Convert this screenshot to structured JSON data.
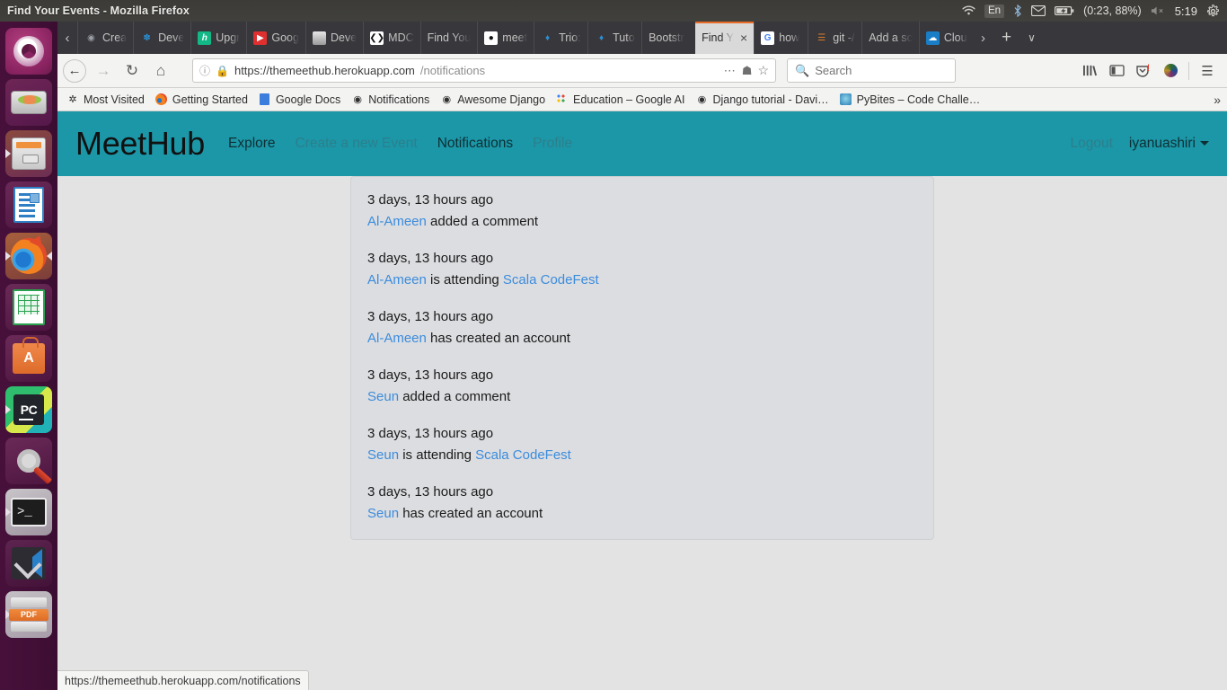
{
  "desktop": {
    "window_title": "Find Your Events - Mozilla Firefox",
    "tray": {
      "wifi_icon": "wifi-icon",
      "language": "En",
      "bluetooth_icon": "bluetooth-icon",
      "mail_icon": "mail-icon",
      "battery_icon": "battery-icon",
      "battery_label": "(0:23, 88%)",
      "volume_icon": "volume-muted-icon",
      "clock": "5:19",
      "gear_icon": "gear-icon"
    },
    "launcher": [
      {
        "name": "ubuntu-dash",
        "running": false
      },
      {
        "name": "disk-usage-analyzer",
        "running": false
      },
      {
        "name": "files-nautilus",
        "running": true
      },
      {
        "name": "libreoffice-writer",
        "running": false
      },
      {
        "name": "firefox",
        "running": true,
        "focused": true
      },
      {
        "name": "libreoffice-calc",
        "running": false
      },
      {
        "name": "ubuntu-software",
        "running": false
      },
      {
        "name": "pycharm",
        "running": true
      },
      {
        "name": "system-settings",
        "running": false
      },
      {
        "name": "terminal",
        "running": true
      },
      {
        "name": "visual-studio-code",
        "running": false
      },
      {
        "name": "pdf-tools",
        "running": true
      }
    ]
  },
  "browser": {
    "tabs": [
      {
        "label": "Crea",
        "favicon": "globe-icon",
        "active": false
      },
      {
        "label": "Deve",
        "favicon": "globe-icon",
        "active": false
      },
      {
        "label": "Upgr",
        "favicon": "hashnode-icon",
        "active": false
      },
      {
        "label": "Goog",
        "favicon": "youtube-icon",
        "active": false
      },
      {
        "label": "Deve",
        "favicon": "document-icon",
        "active": false
      },
      {
        "label": "MDC",
        "favicon": "mdn-icon",
        "active": false
      },
      {
        "label": "Find You",
        "favicon": "none",
        "active": false
      },
      {
        "label": "meet",
        "favicon": "github-icon",
        "active": false
      },
      {
        "label": "Trio:",
        "favicon": "trio-icon",
        "active": false
      },
      {
        "label": "Tuto",
        "favicon": "trio-icon",
        "active": false
      },
      {
        "label": "Bootstr",
        "favicon": "none",
        "active": false
      },
      {
        "label": "Find Y",
        "favicon": "none",
        "active": true
      },
      {
        "label": "how",
        "favicon": "google-icon",
        "active": false
      },
      {
        "label": "git -/",
        "favicon": "git-icon",
        "active": false
      },
      {
        "label": "Add a sc",
        "favicon": "none",
        "active": false
      },
      {
        "label": "Clou",
        "favicon": "cloud-icon",
        "active": false
      }
    ],
    "tab_close_label": "×",
    "new_tab_label": "+",
    "tab_list_label": "∨",
    "scroll_left_label": "‹",
    "scroll_right_label": "›",
    "nav": {
      "back_icon": "back-arrow-icon",
      "forward_icon": "forward-arrow-icon",
      "reload_icon": "reload-icon",
      "home_icon": "home-icon"
    },
    "url": {
      "info_icon": "page-info-icon",
      "lock_icon": "lock-icon",
      "scheme_host": "https://themeethub.herokuapp.com",
      "path": "/notifications",
      "page_actions_icon": "ellipsis-icon",
      "pocket_icon": "pocket-icon",
      "bookmark_star_icon": "star-icon"
    },
    "search": {
      "icon": "search-icon",
      "placeholder": "Search",
      "value": ""
    },
    "toolbar_icons": [
      "library-icon",
      "sidebar-icon",
      "save-to-pocket-icon",
      "account-avatar-icon",
      "hamburger-menu-icon"
    ],
    "bookmarks": [
      {
        "label": "Most Visited",
        "icon": "star-burst-icon"
      },
      {
        "label": "Getting Started",
        "icon": "firefox-icon"
      },
      {
        "label": "Google Docs",
        "icon": "docs-icon"
      },
      {
        "label": "Notifications",
        "icon": "globe-icon"
      },
      {
        "label": "Awesome Django",
        "icon": "globe-icon"
      },
      {
        "label": "Education – Google AI",
        "icon": "google-ai-icon"
      },
      {
        "label": "Django tutorial - Davi…",
        "icon": "globe-icon"
      },
      {
        "label": "PyBites – Code Challe…",
        "icon": "pybites-icon"
      }
    ],
    "bookmarks_overflow_label": "»",
    "status_text": "https://themeethub.herokuapp.com/notifications"
  },
  "site": {
    "brand": "MeetHub",
    "accent_color": "#1b97a8",
    "link_color": "#3b8cdd",
    "nav_links": [
      {
        "label": "Explore",
        "active": true
      },
      {
        "label": "Create a new Event",
        "active": false
      },
      {
        "label": "Notifications",
        "active": true
      },
      {
        "label": "Profile",
        "active": false
      }
    ],
    "logout_label": "Logout",
    "username": "iyanuashiri",
    "notifications": [
      {
        "time": "3 days, 13 hours ago",
        "actor": "Al-Ameen",
        "verb": " added a comment",
        "target": ""
      },
      {
        "time": "3 days, 13 hours ago",
        "actor": "Al-Ameen",
        "verb": " is attending ",
        "target": "Scala CodeFest"
      },
      {
        "time": "3 days, 13 hours ago",
        "actor": "Al-Ameen",
        "verb": " has created an account",
        "target": ""
      },
      {
        "time": "3 days, 13 hours ago",
        "actor": "Seun",
        "verb": " added a comment",
        "target": ""
      },
      {
        "time": "3 days, 13 hours ago",
        "actor": "Seun",
        "verb": " is attending ",
        "target": "Scala CodeFest"
      },
      {
        "time": "3 days, 13 hours ago",
        "actor": "Seun",
        "verb": " has created an account",
        "target": ""
      }
    ]
  }
}
